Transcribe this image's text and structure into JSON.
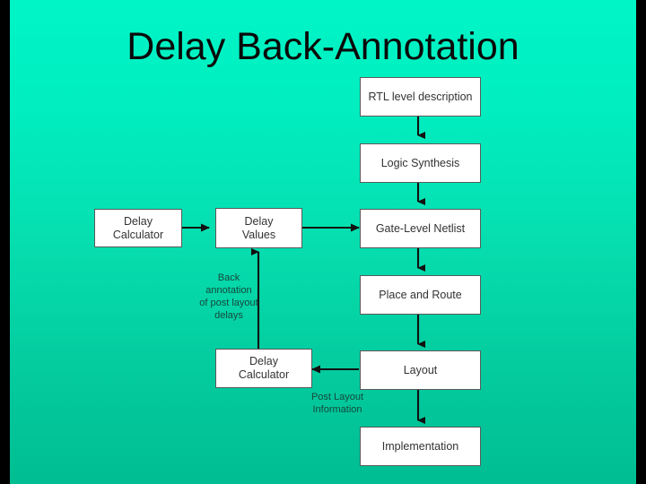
{
  "slide": {
    "title": "Delay Back-Annotation",
    "background_top_color": "#00f5c6",
    "background_bottom_color": "#00bd92",
    "border_color": "#000000",
    "box_fill_color": "#ffffff",
    "box_border_color": "#5a5a5a",
    "box_text_color": "#333333",
    "note_text_color": "#17473c",
    "title_color": "#0a0a0a",
    "arrow_color": "#111111"
  },
  "flow": {
    "main_column": [
      {
        "id": "rtl",
        "label": "RTL level description"
      },
      {
        "id": "synthesis",
        "label": "Logic Synthesis"
      },
      {
        "id": "netlist",
        "label": "Gate-Level Netlist"
      },
      {
        "id": "par",
        "label": "Place and Route"
      },
      {
        "id": "layout",
        "label": "Layout"
      },
      {
        "id": "implementation",
        "label": "Implementation"
      }
    ],
    "side_nodes": [
      {
        "id": "delay-calculator-top",
        "line1": "Delay",
        "line2": "Calculator"
      },
      {
        "id": "delay-values",
        "line1": "Delay",
        "line2": "Values"
      },
      {
        "id": "delay-calculator-bottom",
        "line1": "Delay",
        "line2": "Calculator"
      }
    ],
    "notes": [
      {
        "id": "back-annotation-note",
        "line1": "Back",
        "line2": "annotation",
        "line3": "of post layout",
        "line4": "delays"
      },
      {
        "id": "post-layout-note",
        "line1": "Post Layout",
        "line2": "Information"
      }
    ]
  }
}
